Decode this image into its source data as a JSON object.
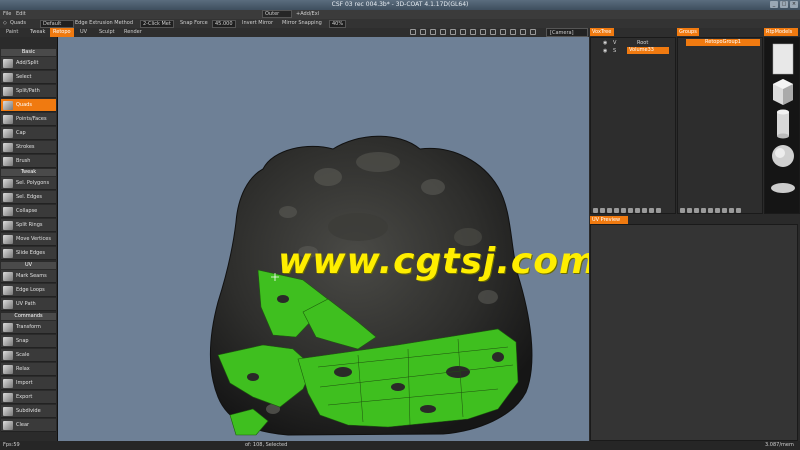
{
  "window": {
    "title": "CSF 03 rec 004.3b* - 3D-COAT 4.1.17D(GL64)"
  },
  "menubar": {
    "items": [
      "File",
      "Edit"
    ],
    "dropdown": "Outer",
    "addmode": "+Add/Exl"
  },
  "tool_options": {
    "mode": "Quads",
    "preset": "Default",
    "extrusion_label": "Edge Extrusion Method",
    "extrusion_value": "2-Click Met",
    "snap_label": "Snap Force",
    "snap_value": "45.000",
    "invert_mirror": "Invert Mirror",
    "mirror_snapping": "Mirror Snapping",
    "mirror_value": "40%"
  },
  "tabs": [
    "Paint",
    "Tweak",
    "Retopo",
    "UV",
    "Sculpt",
    "Render"
  ],
  "active_tab": "Retopo",
  "camera": "[Camera]",
  "left_panel": {
    "sections": [
      {
        "title": "Basic",
        "tools": [
          "Add/Split",
          "Select",
          "Split/Path",
          "Quads",
          "Points/Faces",
          "Cap",
          "Strokes",
          "Brush"
        ]
      },
      {
        "title": "Tweak",
        "tools": [
          "Sel. Polygons",
          "Sel. Edges",
          "Collapse",
          "Split Rings",
          "Move Vertices",
          "Slide Edges"
        ]
      },
      {
        "title": "UV",
        "tools": [
          "Mark Seams",
          "Edge Loops",
          "UV Path"
        ]
      },
      {
        "title": "Commands",
        "tools": [
          "Transform",
          "Snap",
          "Scale",
          "Relax",
          "Import",
          "Export",
          "Subdivide",
          "Clear"
        ]
      }
    ],
    "active_tool": "Quads"
  },
  "voxtree": {
    "title": "VoxTree",
    "root": "Root",
    "root_flag": "V",
    "layer": "Volume33",
    "layer_flag": "S"
  },
  "groups": {
    "title": "Groups",
    "item": "RetopoGroup1"
  },
  "retopo_models": {
    "title": "RtpModels",
    "models": [
      "plane",
      "cube",
      "cylinder",
      "sphere",
      "disc"
    ]
  },
  "uv_preview": {
    "title": "UV Preview"
  },
  "watermark": "www.cgtsj.com",
  "statusbar": {
    "fps": "Fps:59",
    "selection": "of: 108, Selected",
    "memory": "3.087/mem"
  },
  "colors": {
    "accent": "#f07a10",
    "viewport": "#6e8096",
    "retopo_mesh": "#3fbf1f",
    "watermark": "#ffee00"
  }
}
